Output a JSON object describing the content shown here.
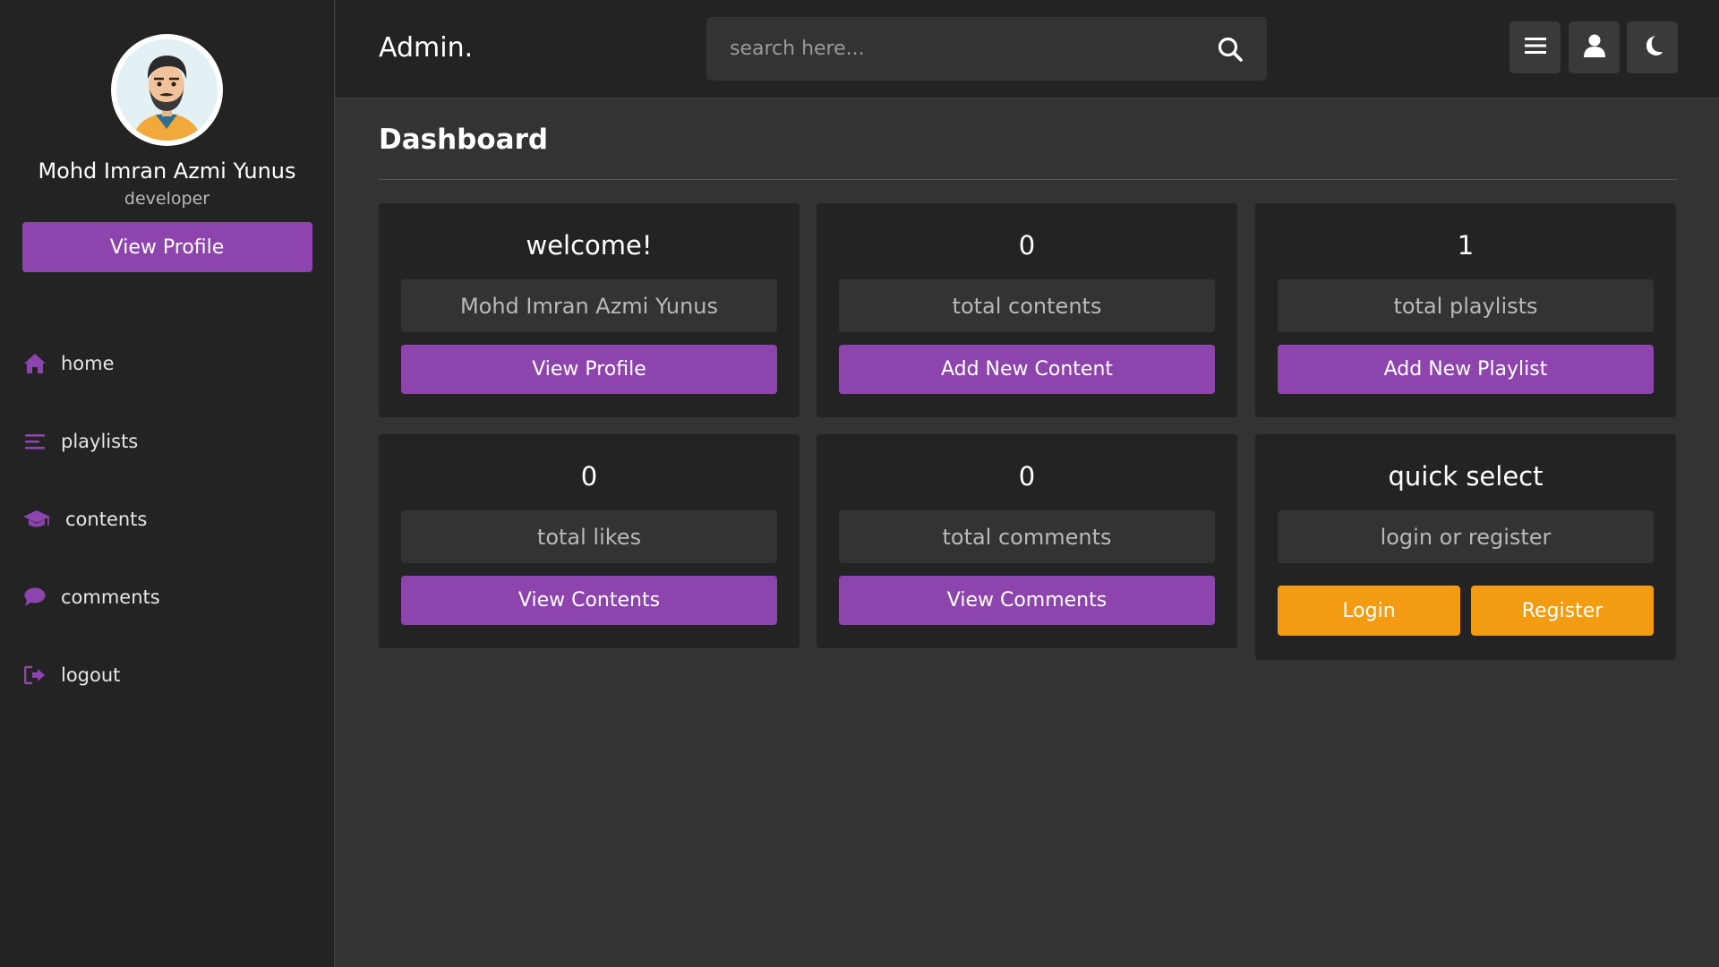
{
  "sidebar": {
    "profile_name": "Mohd Imran Azmi Yunus",
    "profile_role": "developer",
    "view_profile": "View Profile",
    "nav": [
      {
        "label": "home",
        "icon": "home-icon"
      },
      {
        "label": "playlists",
        "icon": "list-icon"
      },
      {
        "label": "contents",
        "icon": "graduation-cap-icon"
      },
      {
        "label": "comments",
        "icon": "comment-icon"
      },
      {
        "label": "logout",
        "icon": "logout-icon"
      }
    ]
  },
  "header": {
    "logo": "Admin.",
    "search_placeholder": "search here...",
    "buttons": [
      "menu-icon",
      "user-icon",
      "moon-icon"
    ]
  },
  "main": {
    "title": "Dashboard",
    "cards": [
      {
        "title": "welcome!",
        "box": "Mohd Imran Azmi Yunus",
        "button": "View Profile"
      },
      {
        "title": "0",
        "box": "total contents",
        "button": "Add New Content"
      },
      {
        "title": "1",
        "box": "total playlists",
        "button": "Add New Playlist"
      },
      {
        "title": "0",
        "box": "total likes",
        "button": "View Contents"
      },
      {
        "title": "0",
        "box": "total comments",
        "button": "View Comments"
      },
      {
        "title": "quick select",
        "box": "login or register",
        "buttons": [
          "Login",
          "Register"
        ]
      }
    ]
  },
  "colors": {
    "accent": "#8e44ad",
    "orange": "#f39c12",
    "sidebar_bg": "#232323",
    "main_bg": "#333333"
  }
}
